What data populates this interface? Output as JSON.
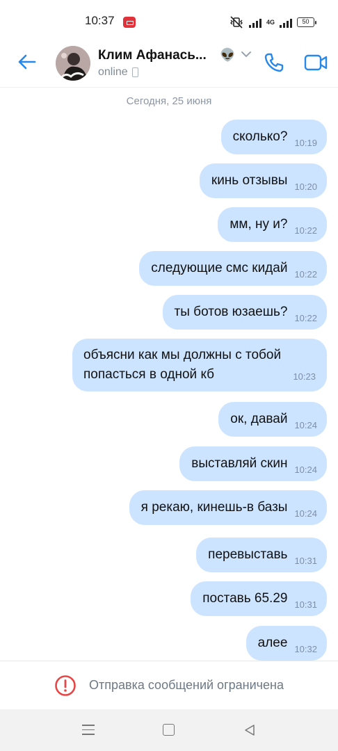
{
  "status_bar": {
    "time": "10:37",
    "network_label": "4G",
    "battery": "50"
  },
  "header": {
    "contact_name": "Клим Афанась...",
    "name_emoji": "👽",
    "status": "online"
  },
  "chat": {
    "date_divider": "Сегодня, 25 июня",
    "messages": [
      {
        "text": "сколько?",
        "time": "10:19"
      },
      {
        "text": "кинь отзывы",
        "time": "10:20"
      },
      {
        "text": "мм, ну и?",
        "time": "10:22"
      },
      {
        "text": "следующие смс кидай",
        "time": "10:22"
      },
      {
        "text": "ты ботов юзаешь?",
        "time": "10:22"
      },
      {
        "text": "объясни как мы должны с тобой попасться в одной кб",
        "time": "10:23"
      },
      {
        "text": "ок, давай",
        "time": "10:24"
      },
      {
        "text": "выставляй скин",
        "time": "10:24"
      },
      {
        "text": "я рекаю, кинешь-в базы",
        "time": "10:24"
      },
      {
        "text": "перевыставь",
        "time": "10:31"
      },
      {
        "text": "поставь 65.29",
        "time": "10:31"
      },
      {
        "text": "алее",
        "time": "10:32"
      }
    ]
  },
  "restriction": {
    "text": "Отправка сообщений ограничена"
  },
  "colors": {
    "accent": "#2688eb",
    "bubble": "#cce4ff",
    "warning": "#e64646"
  }
}
